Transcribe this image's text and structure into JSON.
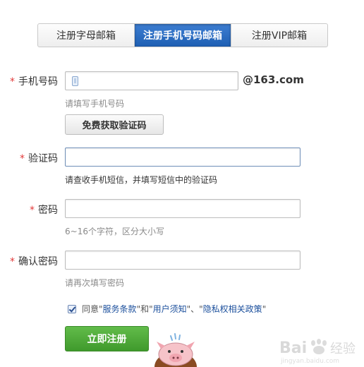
{
  "tabs": [
    {
      "label": "注册字母邮箱",
      "active": false
    },
    {
      "label": "注册手机号码邮箱",
      "active": true
    },
    {
      "label": "注册VIP邮箱",
      "active": false
    }
  ],
  "required_mark": "*",
  "phone": {
    "label": "手机号码",
    "value": "",
    "suffix": "@163.com",
    "hint": "请填写手机号码",
    "get_code_button": "免费获取验证码"
  },
  "code": {
    "label": "验证码",
    "value": "",
    "hint": "请查收手机短信，并填写短信中的验证码"
  },
  "password": {
    "label": "密码",
    "value": "",
    "hint": "6~16个字符，区分大小写"
  },
  "confirm_password": {
    "label": "确认密码",
    "value": "",
    "hint": "请再次填写密码"
  },
  "agreement": {
    "checked": true,
    "prefix": "同意",
    "q1": "\"",
    "term1": "服务条款",
    "mid": "\"和\"",
    "term2": "用户须知",
    "sep": "\"、\"",
    "term3": "隐私权相关政策",
    "q2": "\""
  },
  "submit_button": "立即注册",
  "colors": {
    "accent": "#1e5fb3",
    "submit_green": "#4aa836",
    "required_red": "#e23a3a",
    "link_blue": "#1b4f9c"
  }
}
